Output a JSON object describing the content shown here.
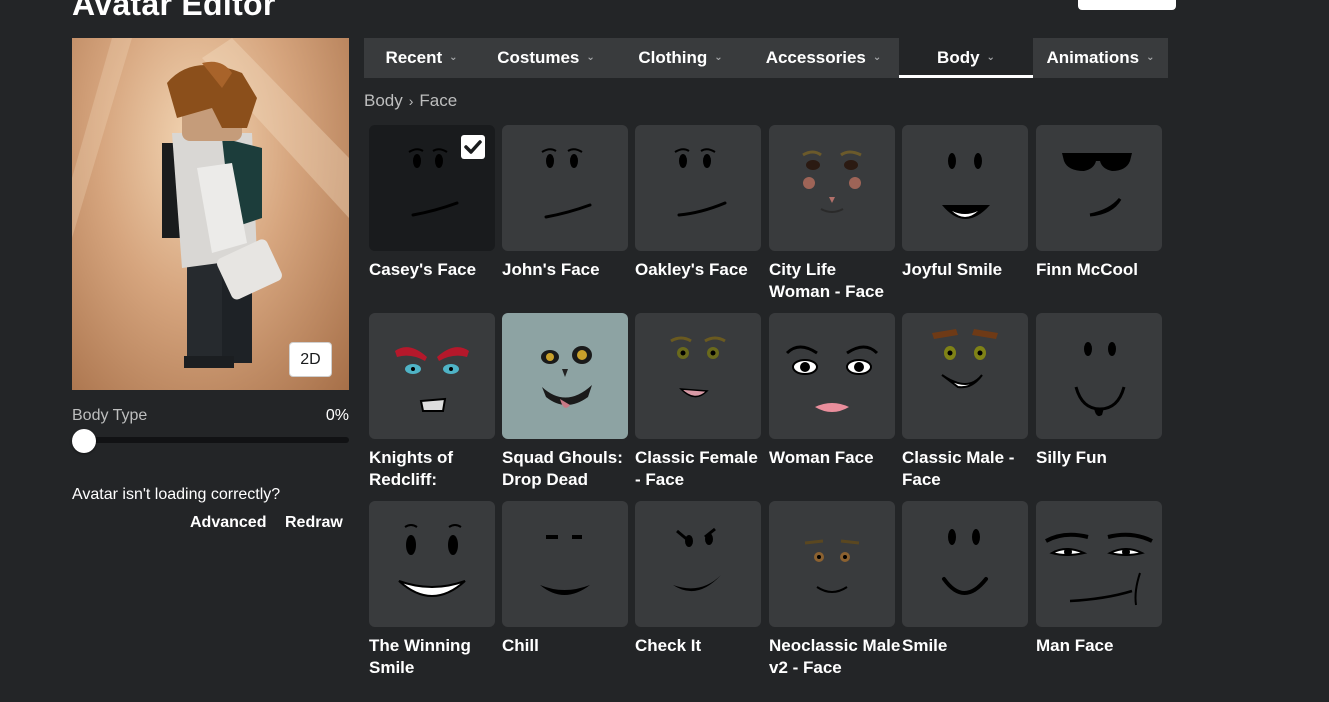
{
  "page": {
    "title": "Avatar Editor"
  },
  "avatar": {
    "toggle_view_label": "2D",
    "body_type_label": "Body Type",
    "body_type_value": "0%",
    "body_type_fraction": 0.0,
    "loading_question": "Avatar isn't loading correctly?",
    "advanced_link": "Advanced",
    "redraw_link": "Redraw"
  },
  "tabs": [
    {
      "label": "Recent",
      "icon": "chevron-down-icon",
      "active": false
    },
    {
      "label": "Costumes",
      "icon": "chevron-down-icon",
      "active": false
    },
    {
      "label": "Clothing",
      "icon": "chevron-down-icon",
      "active": false
    },
    {
      "label": "Accessories",
      "icon": "chevron-down-icon",
      "active": false
    },
    {
      "label": "Body",
      "icon": "chevron-down-icon",
      "active": true
    },
    {
      "label": "Animations",
      "icon": "chevron-down-icon",
      "active": false
    }
  ],
  "breadcrumb": {
    "parent": "Body",
    "current": "Face"
  },
  "items": [
    {
      "name": "Casey's Face",
      "selected": true
    },
    {
      "name": "John's Face",
      "selected": false
    },
    {
      "name": "Oakley's Face",
      "selected": false
    },
    {
      "name": "City Life Woman - Face",
      "selected": false
    },
    {
      "name": "Joyful Smile",
      "selected": false
    },
    {
      "name": "Finn McCool",
      "selected": false
    },
    {
      "name": "Knights of Redcliff:",
      "selected": false
    },
    {
      "name": "Squad Ghouls: Drop Dead",
      "selected": false
    },
    {
      "name": "Classic Female - Face",
      "selected": false
    },
    {
      "name": "Woman Face",
      "selected": false
    },
    {
      "name": "Classic Male - Face",
      "selected": false
    },
    {
      "name": "Silly Fun",
      "selected": false
    },
    {
      "name": "The Winning Smile",
      "selected": false
    },
    {
      "name": "Chill",
      "selected": false
    },
    {
      "name": "Check It",
      "selected": false
    },
    {
      "name": "Neoclassic Male v2 - Face",
      "selected": false
    },
    {
      "name": "Smile",
      "selected": false
    },
    {
      "name": "Man Face",
      "selected": false
    }
  ],
  "colors": {
    "background": "#232527",
    "tab_bar": "#393b3d",
    "card": "#393b3d",
    "card_selected": "#191b1d",
    "text": "#ffffff",
    "muted_text": "#bdbebe"
  }
}
